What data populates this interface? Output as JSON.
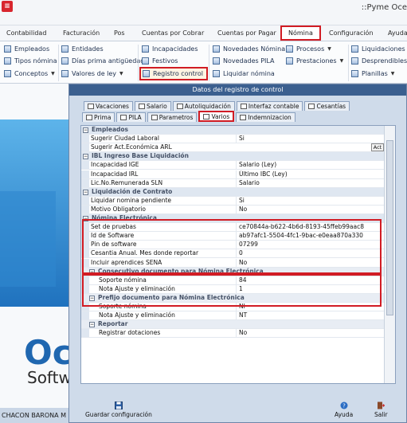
{
  "app": {
    "title": "::Pyme Oce"
  },
  "menu_tabs": [
    {
      "label": "Contabilidad"
    },
    {
      "label": "Facturación"
    },
    {
      "label": "Pos"
    },
    {
      "label": "Cuentas por Cobrar"
    },
    {
      "label": "Cuentas por Pagar"
    },
    {
      "label": "Nómina"
    },
    {
      "label": "Configuración"
    },
    {
      "label": "Ayuda"
    }
  ],
  "ribbon": {
    "empleados": "Empleados",
    "tipos_nomina": "Tipos nómina",
    "conceptos": "Conceptos",
    "entidades": "Entidades",
    "dias_prima": "Días prima antigüedad",
    "valores_ley": "Valores de ley",
    "incapacidades": "Incapacidades",
    "festivos": "Festivos",
    "registro_control": "Registro control",
    "novedades_nomina": "Novedades Nómina",
    "novedades_pila": "Novedades PILA",
    "liquidar_nomina": "Liquidar nómina",
    "procesos": "Procesos",
    "prestaciones": "Prestaciones",
    "liquidaciones": "Liquidaciones",
    "desprendibles": "Desprendibles",
    "planillas": "Planillas"
  },
  "dialog": {
    "title": "Datos del registro de control",
    "tabs_top": [
      "Vacaciones",
      "Salario",
      "Autoliquidación",
      "Interfaz contable",
      "Cesantías"
    ],
    "tabs_bottom": [
      "Prima",
      "PILA",
      "Parametros",
      "Varios",
      "Indemnizacion"
    ],
    "active_tab": "Varios",
    "save_label": "Guardar configuración",
    "help_label": "Ayuda",
    "exit_label": "Salir"
  },
  "property_rows": [
    {
      "type": "cat",
      "label": "Empleados"
    },
    {
      "type": "prop",
      "name": "Sugerir Ciudad Laboral",
      "value": "Si"
    },
    {
      "type": "prop",
      "name": "Sugerir Act.Económica ARL",
      "value": "",
      "button": "Act"
    },
    {
      "type": "cat",
      "label": "IBL Ingreso Base Liquidación"
    },
    {
      "type": "prop",
      "name": "Incapacidad IGE",
      "value": "Salario    (Ley)"
    },
    {
      "type": "prop",
      "name": "Incapacidad IRL",
      "value": "Último IBC    (Ley)"
    },
    {
      "type": "prop",
      "name": "Lic.No.Remunerada SLN",
      "value": "Salario"
    },
    {
      "type": "cat",
      "label": "Liquidación de Contrato"
    },
    {
      "type": "prop",
      "name": "Liquidar nomina pendiente",
      "value": "Si"
    },
    {
      "type": "prop",
      "name": "Motivo Obligatorio",
      "value": "No"
    },
    {
      "type": "cat",
      "label": "Nómina Electrónica"
    },
    {
      "type": "prop",
      "name": "Set de pruebas",
      "value": "ce70844a-b622-4b6d-8193-45ffeb99aac8"
    },
    {
      "type": "prop",
      "name": "Id de Software",
      "value": "ab97afc1-5504-4fc1-9bac-e0eaa870a330"
    },
    {
      "type": "prop",
      "name": "Pin de software",
      "value": "07299"
    },
    {
      "type": "prop",
      "name": "Cesantia Anual. Mes donde reportar",
      "value": "0"
    },
    {
      "type": "prop",
      "name": "Incluir aprendices SENA",
      "value": "No"
    },
    {
      "type": "sub",
      "label": "Consecutivo documento para Nómina Electrónica"
    },
    {
      "type": "prop2",
      "name": "Soporte nómina",
      "value": "84"
    },
    {
      "type": "prop2",
      "name": "Nota Ajuste y eliminación",
      "value": "1"
    },
    {
      "type": "sub",
      "label": "Prefijo documento para Nómina Electrónica"
    },
    {
      "type": "prop2",
      "name": "Soporte nómina",
      "value": "NI"
    },
    {
      "type": "prop2",
      "name": "Nota Ajuste y eliminación",
      "value": "NT"
    },
    {
      "type": "sub",
      "label": "Reportar"
    },
    {
      "type": "prop2",
      "name": "Registrar dotaciones",
      "value": "No"
    }
  ],
  "background": {
    "logo_text": "Oc",
    "logo_sub": "Softw",
    "status_user": "CHACON BARONA M"
  }
}
